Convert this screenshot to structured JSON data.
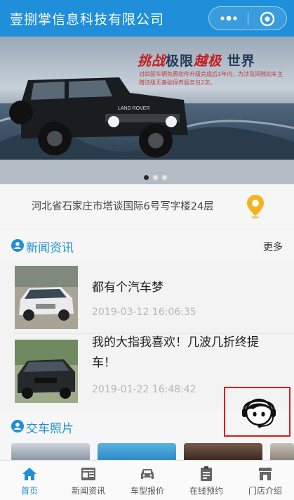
{
  "titlebar": {
    "title": "壹捌掌信息科技有限公司"
  },
  "banner": {
    "slogan_red": "挑战",
    "slogan_mid": "极限",
    "slogan_red2": "越极",
    "slogan_end": "世界",
    "sub_text": "对四驱车辆免费软件升级完成后1年内，为涉及间隙的车主赠送级无基础保养服务包2次。",
    "car_brand": "LAND ROVER"
  },
  "address": {
    "text": "河北省石家庄市塔谈国际6号写字楼24层"
  },
  "news_section": {
    "title": "新闻资讯",
    "more": "更多"
  },
  "news": [
    {
      "headline": "都有个汽车梦",
      "date": "2019-03-12 16:06:35"
    },
    {
      "headline": "我的大指我喜欢！几波几折终提车！",
      "date": "2019-01-22 16:48:42"
    }
  ],
  "photo_section": {
    "title": "交车照片"
  },
  "tabs": [
    {
      "label": "首页",
      "icon": "home-icon"
    },
    {
      "label": "新闻资讯",
      "icon": "newspaper-icon"
    },
    {
      "label": "车型报价",
      "icon": "car-icon"
    },
    {
      "label": "在线预约",
      "icon": "clipboard-icon"
    },
    {
      "label": "门店介绍",
      "icon": "store-icon"
    }
  ],
  "colors": {
    "primary": "#1e8fd8",
    "badge_border": "#e01b1b",
    "pin": "#f5b31c"
  }
}
